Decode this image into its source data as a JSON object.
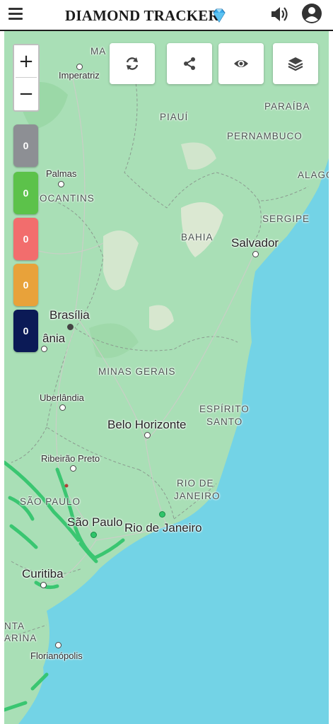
{
  "header": {
    "title": "DIAMOND TRACKER"
  },
  "map": {
    "zoom_in": "+",
    "zoom_out": "−",
    "states": {
      "maranhao": "MA",
      "piaui": "PIAUÍ",
      "paraiba": "PARAÍBA",
      "pernambuco": "PERNAMBUCO",
      "alagoas": "ALAGO",
      "sergipe": "SERGIPE",
      "bahia": "BAHIA",
      "tocantins": "OCANTINS",
      "minas_gerais": "MINAS GERAIS",
      "espirito_santo_1": "ESPÍRITO",
      "espirito_santo_2": "SANTO",
      "rio_1": "RIO DE",
      "rio_2": "JANEIRO",
      "sao_paulo_state": "SÃO PAULO",
      "santa_catarina_1": "NTA",
      "santa_catarina_2": "ARINA"
    },
    "cities": {
      "imperatriz": "Imperatriz",
      "palmas": "Palmas",
      "salvador": "Salvador",
      "brasilia": "Brasília",
      "goiania": "ânia",
      "uberlandia": "Uberlândia",
      "belo_horizonte": "Belo Horizonte",
      "ribeirao_preto": "Ribeirão Preto",
      "sao_paulo": "São Paulo",
      "rio_de_janeiro": "Rio de Janeiro",
      "curitiba": "Curitiba",
      "florianopolis": "Florianópolis"
    }
  },
  "counters": [
    {
      "value": "0",
      "color": "#8d8f94"
    },
    {
      "value": "0",
      "color": "#5cc24a"
    },
    {
      "value": "0",
      "color": "#f26d6d"
    },
    {
      "value": "0",
      "color": "#e8a23a"
    },
    {
      "value": "0",
      "color": "#0b1a56"
    }
  ],
  "controls": [
    "refresh-icon",
    "share-icon",
    "eye-icon",
    "layers-icon"
  ],
  "colors": {
    "land": "#a9dfb6",
    "ocean": "#73d3e6",
    "diamond": "#3aa8e8"
  }
}
